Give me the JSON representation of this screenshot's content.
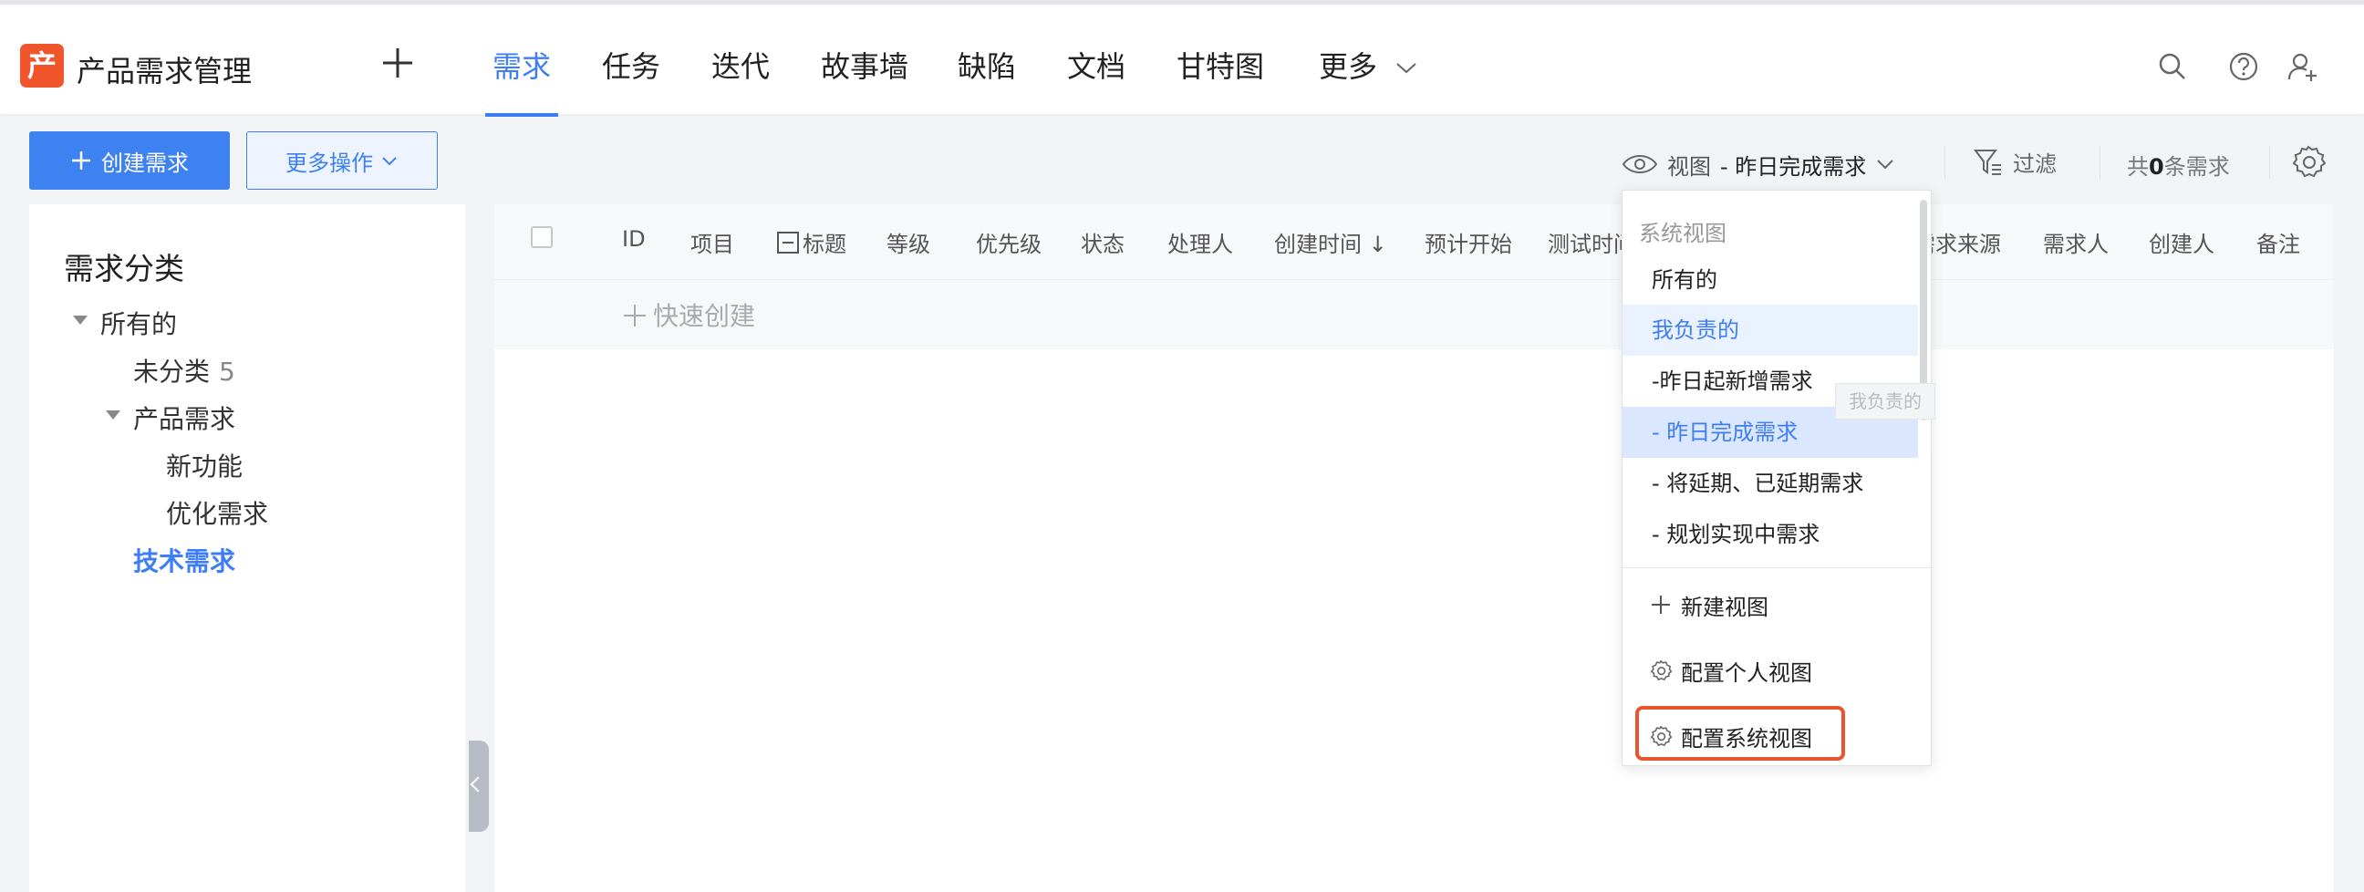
{
  "app": {
    "logo_char": "产",
    "title": "产品需求管理"
  },
  "nav": {
    "items": [
      "需求",
      "任务",
      "迭代",
      "故事墙",
      "缺陷",
      "文档",
      "甘特图",
      "更多"
    ],
    "active": "需求"
  },
  "toolbar": {
    "create_label": "创建需求",
    "more_label": "更多操作",
    "view_label": "视图",
    "view_value": "- 昨日完成需求",
    "filter_label": "过滤",
    "count_prefix": "共",
    "count_value": "0",
    "count_suffix": "条需求"
  },
  "sidebar": {
    "title": "需求分类",
    "tree": [
      {
        "label": "所有的",
        "count": "",
        "level": 0,
        "expandable": true
      },
      {
        "label": "未分类",
        "count": "5",
        "level": 1,
        "expandable": false
      },
      {
        "label": "产品需求",
        "count": "",
        "level": 1,
        "expandable": true
      },
      {
        "label": "新功能",
        "count": "",
        "level": 2,
        "expandable": false
      },
      {
        "label": "优化需求",
        "count": "",
        "level": 2,
        "expandable": false
      },
      {
        "label": "技术需求",
        "count": "",
        "level": 1,
        "expandable": false,
        "active": true
      }
    ]
  },
  "table": {
    "columns": [
      "ID",
      "项目",
      "标题",
      "等级",
      "优先级",
      "状态",
      "处理人",
      "创建时间 ↓",
      "预计开始",
      "测试时间",
      "需求来源",
      "需求人",
      "创建人",
      "备注"
    ],
    "quick_create": "快速创建"
  },
  "view_menu": {
    "group_label": "系统视图",
    "items": [
      "所有的",
      "我负责的",
      "-昨日起新增需求",
      "- 昨日完成需求",
      "- 将延期、已延期需求",
      "- 规划实现中需求"
    ],
    "hovered": "我负责的",
    "selected": "- 昨日完成需求",
    "tooltip": "我负责的",
    "actions": {
      "new_view": "新建视图",
      "config_personal": "配置个人视图",
      "config_system": "配置系统视图"
    }
  },
  "colors": {
    "accent": "#3d7df5",
    "logo": "#f0552c",
    "highlight": "#e8542e"
  }
}
